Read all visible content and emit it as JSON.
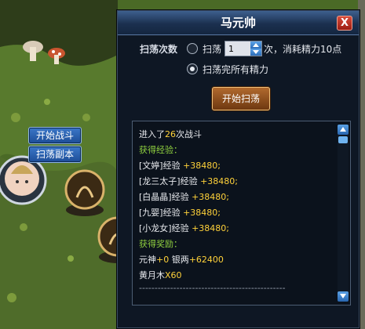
{
  "left_buttons": {
    "start_battle": "开始战斗",
    "sweep_dungeon": "扫荡副本"
  },
  "dialog": {
    "title": "马元帅",
    "close": "X",
    "sweep_label": "扫荡次数",
    "option1_prefix": "扫荡",
    "count_value": "1",
    "option1_suffix": "次，消耗精力10点",
    "option2": "扫荡完所有精力",
    "start_button": "开始扫荡"
  },
  "log": {
    "line1_a": "进入了",
    "line1_num": "26",
    "line1_b": "次战斗",
    "exp_header": "获得经验：",
    "exp": [
      {
        "name": "[文婷]经验",
        "val": "+38480;"
      },
      {
        "name": "[龙三太子]经验",
        "val": "+38480;"
      },
      {
        "name": "[白晶晶]经验",
        "val": "+38480;"
      },
      {
        "name": "[九婴]经验",
        "val": "+38480;"
      },
      {
        "name": "[小龙女]经验",
        "val": "+38480;"
      }
    ],
    "reward_header": "获得奖励：",
    "reward_a": "元神",
    "reward_a_val": "+0",
    "reward_b": " 银两",
    "reward_b_val": "+62400",
    "item_name": "黄月木",
    "item_val": "X60",
    "divider": "-----------------------------------------------"
  }
}
